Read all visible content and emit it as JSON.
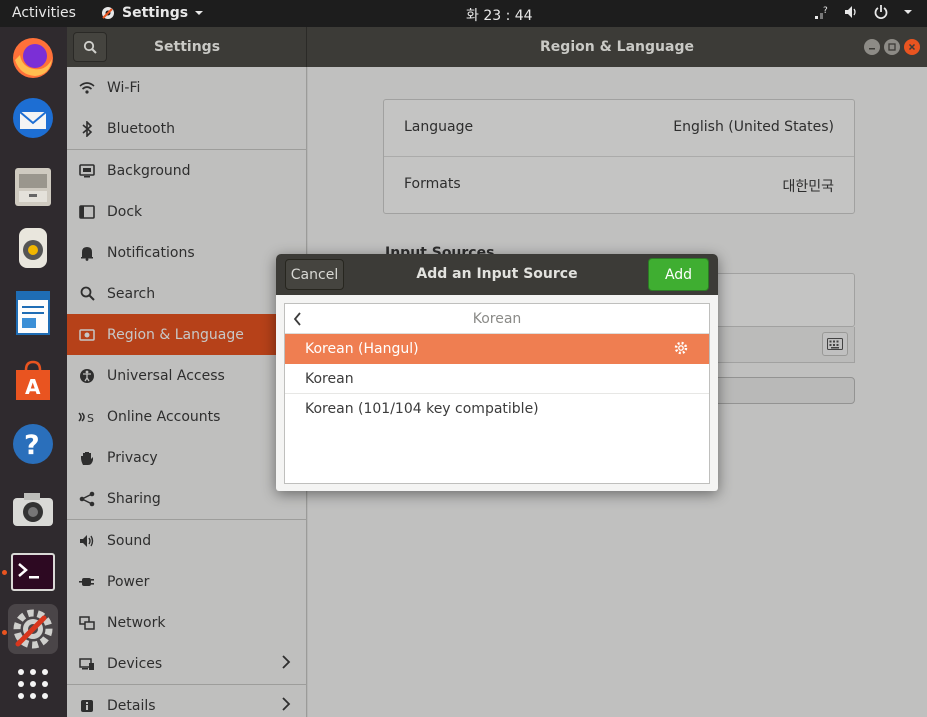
{
  "topbar": {
    "activities": "Activities",
    "app_menu": "Settings",
    "clock": "화 23 : 44"
  },
  "window": {
    "sidebar_title": "Settings",
    "title": "Region & Language"
  },
  "sidebar": {
    "items": [
      {
        "label": "Wi-Fi",
        "icon": "wifi-icon"
      },
      {
        "label": "Bluetooth",
        "icon": "bluetooth-icon"
      },
      {
        "label": "Background",
        "icon": "background-icon"
      },
      {
        "label": "Dock",
        "icon": "dock-icon"
      },
      {
        "label": "Notifications",
        "icon": "bell-icon"
      },
      {
        "label": "Search",
        "icon": "search-icon"
      },
      {
        "label": "Region & Language",
        "icon": "flag-icon",
        "selected": true
      },
      {
        "label": "Universal Access",
        "icon": "accessibility-icon"
      },
      {
        "label": "Online Accounts",
        "icon": "online-accounts-icon"
      },
      {
        "label": "Privacy",
        "icon": "hand-icon"
      },
      {
        "label": "Sharing",
        "icon": "share-icon"
      },
      {
        "label": "Sound",
        "icon": "speaker-icon"
      },
      {
        "label": "Power",
        "icon": "plug-icon"
      },
      {
        "label": "Network",
        "icon": "network-icon"
      },
      {
        "label": "Devices",
        "icon": "devices-icon"
      },
      {
        "label": "Details",
        "icon": "info-icon"
      }
    ]
  },
  "region": {
    "language_label": "Language",
    "language_value": "English (United States)",
    "formats_label": "Formats",
    "formats_value": "대한민국",
    "input_sources_title": "Input Sources"
  },
  "dialog": {
    "cancel": "Cancel",
    "title": "Add an Input Source",
    "add": "Add",
    "group": "Korean",
    "items": [
      {
        "label": "Korean (Hangul)",
        "selected": true
      },
      {
        "label": "Korean"
      },
      {
        "label": "Korean (101/104 key compatible)"
      }
    ]
  },
  "colors": {
    "accent": "#e95420",
    "selection": "#ef7e51",
    "add_button": "#3fae31"
  }
}
